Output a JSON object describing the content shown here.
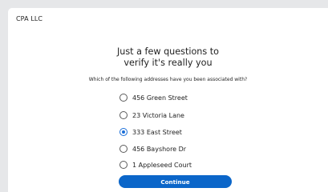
{
  "brand": {
    "name": "CPA LLC"
  },
  "heading": {
    "line1": "Just a few questions to",
    "line2": "verify it's really you"
  },
  "question": "Which of the following addresses have you been associated with?",
  "options": [
    {
      "label": "456 Green Street",
      "selected": false
    },
    {
      "label": "23 Victoria Lane",
      "selected": false
    },
    {
      "label": "333 East Street",
      "selected": true
    },
    {
      "label": "456 Bayshore Dr",
      "selected": false
    },
    {
      "label": "1 Appleseed Court",
      "selected": false
    }
  ],
  "continue_button": {
    "label": "Continue"
  },
  "colors": {
    "accent": "#0b66c9",
    "radio_selected": "#1a6ed8",
    "background": "#e6e7e9",
    "card": "#ffffff"
  }
}
